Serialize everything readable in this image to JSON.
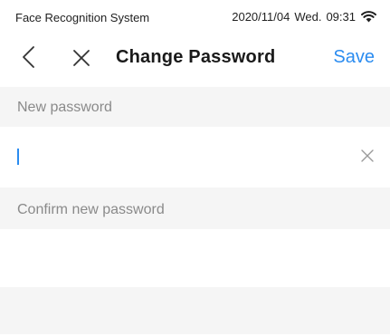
{
  "status_bar": {
    "app_name": "Face Recognition System",
    "date": "2020/11/04",
    "weekday": "Wed.",
    "time": "09:31",
    "wifi_icon": "wifi-icon"
  },
  "nav": {
    "back_icon": "chevron-left-icon",
    "close_icon": "close-icon",
    "title": "Change Password",
    "save_label": "Save"
  },
  "form": {
    "new_password_label": "New password",
    "new_password_value": "",
    "clear_icon": "close-icon",
    "confirm_password_label": "Confirm new password",
    "confirm_password_value": ""
  },
  "colors": {
    "accent": "#2b8cf0",
    "section_background": "#f5f5f5",
    "label_text": "#8a8a8a"
  }
}
